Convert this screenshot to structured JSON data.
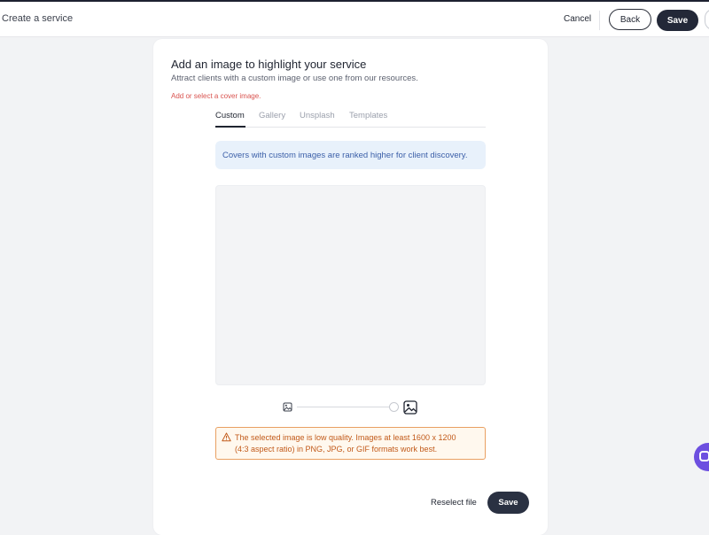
{
  "header": {
    "title": "Create a service",
    "cancel_label": "Cancel",
    "back_label": "Back",
    "save_label": "Save"
  },
  "card": {
    "title": "Add an image to highlight your service",
    "subtitle": "Attract clients with a custom image or use one from our resources.",
    "error": "Add or select a cover image.",
    "tabs": [
      {
        "label": "Custom",
        "active": true
      },
      {
        "label": "Gallery",
        "active": false
      },
      {
        "label": "Unsplash",
        "active": false
      },
      {
        "label": "Templates",
        "active": false
      }
    ],
    "info_message": "Covers with custom images are ranked higher for client discovery.",
    "zoom": {
      "small_icon": "image-small-icon",
      "large_icon": "image-large-icon",
      "level": 1.0
    },
    "warning": {
      "icon": "warning-triangle-icon",
      "line1": "The selected image is low quality. Images at least 1600 x 1200",
      "line2": "(4:3 aspect ratio) in PNG, JPG, or GIF formats work best."
    },
    "reselect_label": "Reselect file",
    "save_label": "Save"
  },
  "colors": {
    "primary_dark": "#232838",
    "error": "#d9534f",
    "info_bg": "#e8f1fb",
    "info_text": "#3b5fa8",
    "warning_border": "#e9a062",
    "warning_text": "#c25a1a",
    "chat_accent": "#6d4fe0"
  },
  "chat": {
    "icon": "chat-icon"
  }
}
